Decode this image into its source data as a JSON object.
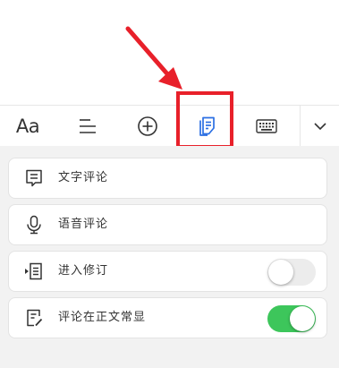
{
  "colors": {
    "accent_red": "#e8202a",
    "toggle_on": "#3dc65b",
    "toggle_off": "#ececec",
    "panel_bg": "#f2f2f2"
  },
  "toolbar": {
    "font_button_label": "Aa",
    "items": [
      {
        "icon": "text-format-icon"
      },
      {
        "icon": "align-icon"
      },
      {
        "icon": "add-circle-icon"
      },
      {
        "icon": "comment-doc-icon"
      },
      {
        "icon": "keyboard-icon"
      },
      {
        "icon": "chevron-down-icon"
      }
    ]
  },
  "menu": {
    "text_comment": {
      "label": "文字评论",
      "icon": "comment-text-icon"
    },
    "voice_comment": {
      "label": "语音评论",
      "icon": "microphone-icon"
    },
    "revision_mode": {
      "label": "进入修订",
      "icon": "revision-icon",
      "enabled": false
    },
    "show_comments": {
      "label": "评论在正文常显",
      "icon": "doc-pen-icon",
      "enabled": true
    }
  }
}
